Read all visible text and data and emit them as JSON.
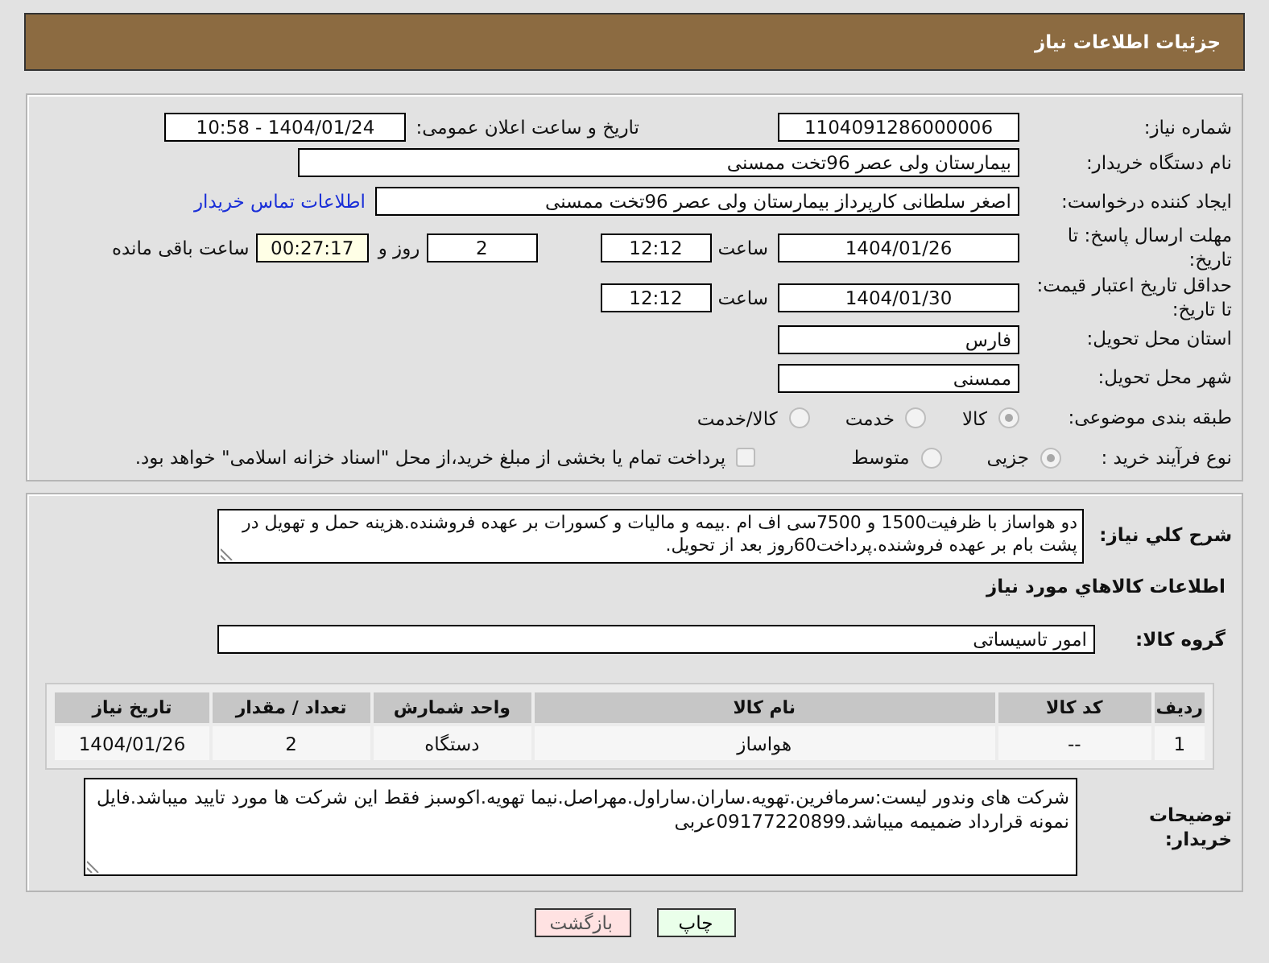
{
  "header": {
    "title": "جزئیات اطلاعات نیاز"
  },
  "need_number": {
    "label": "شماره نیاز:",
    "value": "1104091286000006"
  },
  "announce": {
    "label": "تاریخ و ساعت اعلان عمومی:",
    "value": "1404/01/24 - 10:58"
  },
  "buyer_org": {
    "label": "نام دستگاه خریدار:",
    "value": "بیمارستان ولی عصر  96تخت ممسنی"
  },
  "requester": {
    "label": "ایجاد کننده درخواست:",
    "value": "اصغر سلطانی کارپرداز بیمارستان ولی عصر  96تخت ممسنی",
    "link": "اطلاعات تماس خریدار"
  },
  "deadline": {
    "label": "مهلت ارسال پاسخ: تا تاریخ:",
    "date": "1404/01/26",
    "time_label": "ساعت",
    "time": "12:12",
    "days": "2",
    "days_label": "روز و",
    "remaining": "00:27:17",
    "remaining_label": "ساعت باقی مانده"
  },
  "price_validity": {
    "label": "حداقل تاریخ اعتبار قیمت: تا تاریخ:",
    "date": "1404/01/30",
    "time_label": "ساعت",
    "time": "12:12"
  },
  "province": {
    "label": "استان محل تحویل:",
    "value": "فارس"
  },
  "city": {
    "label": "شهر محل تحویل:",
    "value": "ممسنی"
  },
  "category": {
    "label": "طبقه بندی موضوعی:",
    "options": [
      {
        "label": "کالا",
        "selected": true
      },
      {
        "label": "خدمت",
        "selected": false
      },
      {
        "label": "کالا/خدمت",
        "selected": false
      }
    ]
  },
  "process": {
    "label": "نوع فرآیند خرید :",
    "options": [
      {
        "label": "جزیی",
        "selected": true
      },
      {
        "label": "متوسط",
        "selected": false
      }
    ],
    "payment_note": {
      "label": "پرداخت تمام یا بخشی از مبلغ خرید،از محل \"اسناد خزانه اسلامی\" خواهد بود.",
      "checked": false
    }
  },
  "description": {
    "label": "شرح کلي نياز:",
    "text": "دو هواساز با ظرفیت1500 و 7500سی اف ام .بیمه و مالیات و کسورات بر عهده فروشنده.هزینه حمل و تهویل در پشت بام بر عهده فروشنده.پرداخت60روز بعد از تحویل."
  },
  "goods_title": "اطلاعات کالاهاي مورد نياز",
  "goods_group": {
    "label": "گروه کالا:",
    "value": "امور تاسیساتی"
  },
  "table": {
    "columns": [
      "ردیف",
      "کد کالا",
      "نام کالا",
      "واحد شمارش",
      "تعداد / مقدار",
      "تاریخ نیاز"
    ],
    "rows": [
      [
        "1",
        "--",
        "هواساز",
        "دستگاه",
        "2",
        "1404/01/26"
      ]
    ]
  },
  "buyer_notes": {
    "label": "توضیحات خریدار:",
    "text": "شرکت های وندور لیست:سرمافرین.تهویه.ساران.ساراول.مهراصل.نیما تهویه.اکوسبز فقط این شرکت ها مورد تایید میباشد.فایل نمونه قرارداد ضمیمه میباشد.09177220899عربی"
  },
  "buttons": [
    {
      "kind": "print",
      "label": "چاپ"
    },
    {
      "kind": "back",
      "label": "بازگشت"
    }
  ]
}
